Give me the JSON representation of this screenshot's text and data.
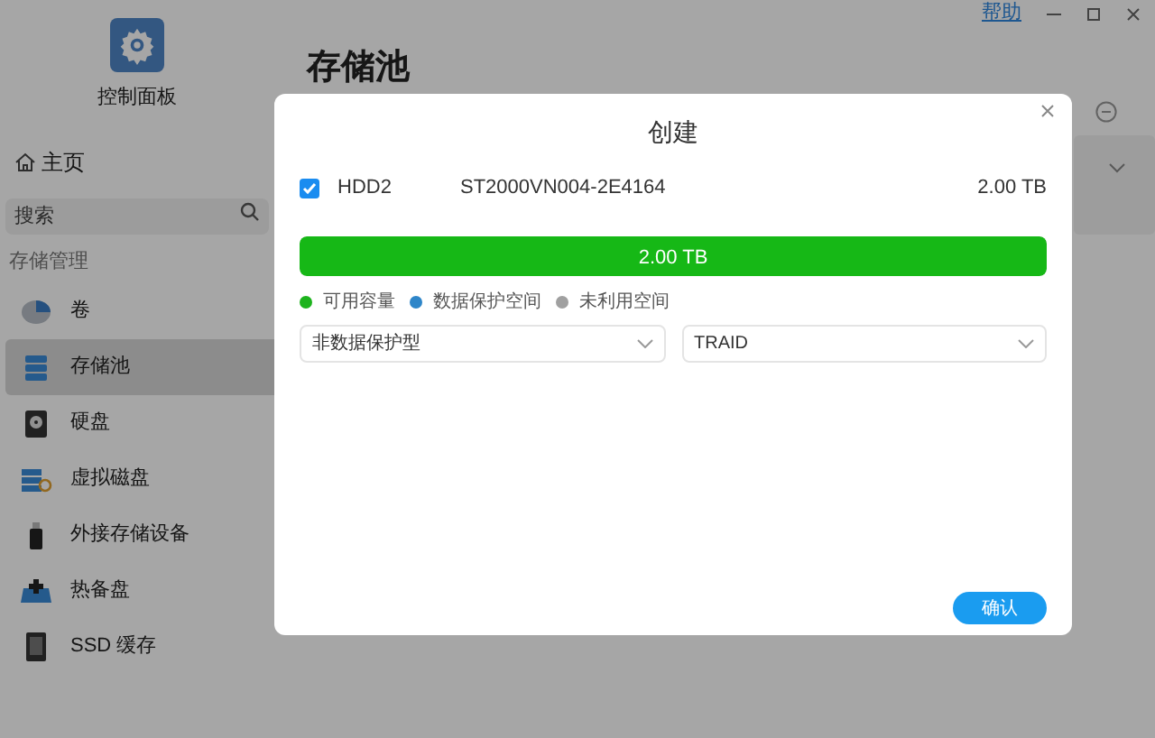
{
  "sidebar": {
    "app_title": "控制面板",
    "home": "主页",
    "search": {
      "placeholder": "搜索"
    },
    "section": "存储管理",
    "items": [
      {
        "label": "卷",
        "kind": "pie",
        "selected": false
      },
      {
        "label": "存储池",
        "kind": "stack",
        "selected": true
      },
      {
        "label": "硬盘",
        "kind": "disk",
        "selected": false
      },
      {
        "label": "虚拟磁盘",
        "kind": "vdisk",
        "selected": false
      },
      {
        "label": "外接存储设备",
        "kind": "usb",
        "selected": false
      },
      {
        "label": "热备盘",
        "kind": "spare",
        "selected": false
      },
      {
        "label": "SSD 缓存",
        "kind": "ssd",
        "selected": false
      }
    ]
  },
  "top_bar": {
    "help": "帮助"
  },
  "page_title": "存储池",
  "dialog": {
    "title": "创建",
    "disks": [
      {
        "checked": true,
        "name": "HDD2",
        "model": "ST2000VN004-2E4164",
        "size": "2.00 TB"
      }
    ],
    "capacity_bar": {
      "level": 1,
      "label": "2.00 TB"
    },
    "legend": [
      {
        "label": "可用容量",
        "color": "#1db31d"
      },
      {
        "label": "数据保护空间",
        "color": "#2e86c9"
      },
      {
        "label": "未利用空间",
        "color": "#a0a0a0"
      }
    ],
    "selects": [
      {
        "value": "非数据保护型"
      },
      {
        "value": "TRAID"
      }
    ],
    "confirm": "确认"
  }
}
